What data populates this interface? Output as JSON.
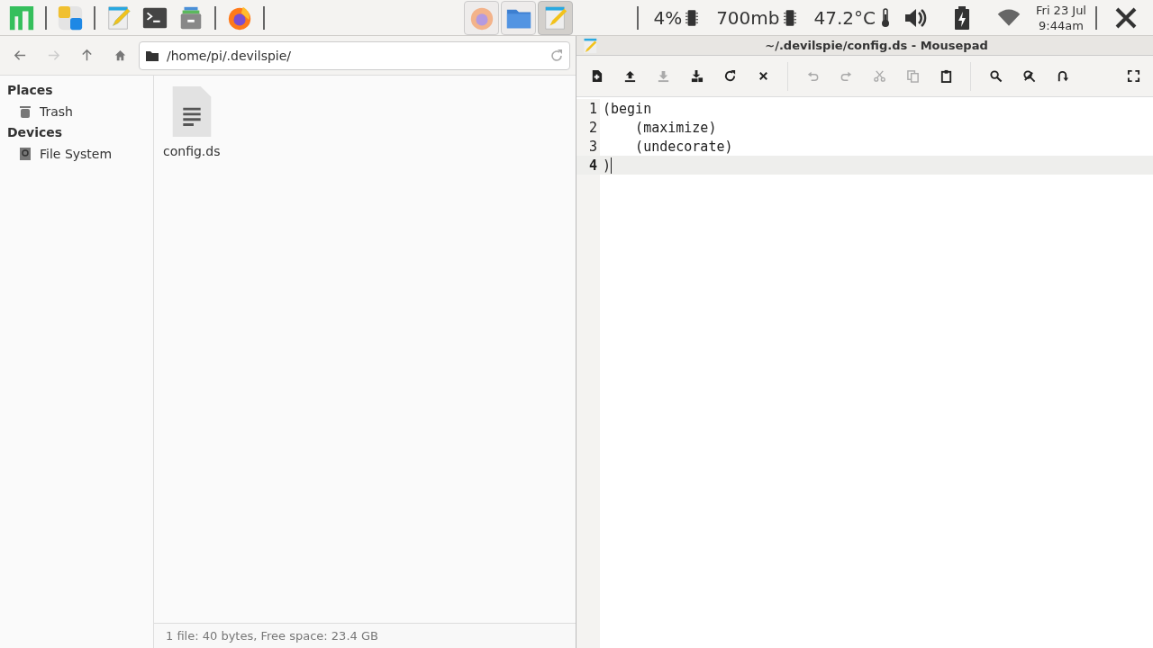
{
  "panel": {
    "launchers": [
      {
        "kind": "logo"
      },
      {
        "kind": "ob"
      },
      {
        "kind": "editor"
      },
      {
        "kind": "terminal"
      },
      {
        "kind": "archive"
      },
      {
        "kind": "browser"
      }
    ],
    "tasks": [
      {
        "kind": "browser",
        "selected": false
      },
      {
        "kind": "folder",
        "selected": false
      },
      {
        "kind": "editor",
        "selected": true
      }
    ],
    "tray": {
      "cpu": "4%",
      "memory": "700mb",
      "temperature": "47.2°C",
      "date": "Fri 23 Jul",
      "time": "9:44am"
    }
  },
  "file_manager": {
    "nav": [
      {
        "kind": "back",
        "disabled": false
      },
      {
        "kind": "forward",
        "disabled": true
      },
      {
        "kind": "up",
        "disabled": false
      },
      {
        "kind": "home",
        "disabled": false
      }
    ],
    "path": "/home/pi/.devilspie/",
    "sidebar": [
      {
        "heading": "Places",
        "items": [
          {
            "kind": "trash",
            "label": "Trash"
          }
        ]
      },
      {
        "heading": "Devices",
        "items": [
          {
            "kind": "drive",
            "label": "File System"
          }
        ]
      }
    ],
    "files": [
      {
        "name": "config.ds"
      }
    ],
    "status_bar": "1 file: 40 bytes, Free space: 23.4 GB"
  },
  "editor": {
    "title": "~/.devilspie/config.ds - Mousepad",
    "toolbar": [
      [
        {
          "kind": "new",
          "disabled": false
        },
        {
          "kind": "open",
          "disabled": false
        },
        {
          "kind": "save",
          "disabled": true
        },
        {
          "kind": "save-as",
          "disabled": false
        },
        {
          "kind": "reload",
          "disabled": false
        },
        {
          "kind": "close",
          "disabled": false
        }
      ],
      [
        {
          "kind": "undo",
          "disabled": true
        },
        {
          "kind": "redo",
          "disabled": true
        },
        {
          "kind": "cut",
          "disabled": true
        },
        {
          "kind": "copy",
          "disabled": true
        },
        {
          "kind": "paste",
          "disabled": false
        }
      ],
      [
        {
          "kind": "find",
          "disabled": false
        },
        {
          "kind": "replace",
          "disabled": false
        },
        {
          "kind": "goto",
          "disabled": false
        }
      ]
    ],
    "lines": [
      {
        "number": "1",
        "text": "(begin",
        "current": false
      },
      {
        "number": "2",
        "text": "    (maximize)",
        "current": false
      },
      {
        "number": "3",
        "text": "    (undecorate)",
        "current": false
      },
      {
        "number": "4",
        "text": ")",
        "current": true
      }
    ]
  }
}
